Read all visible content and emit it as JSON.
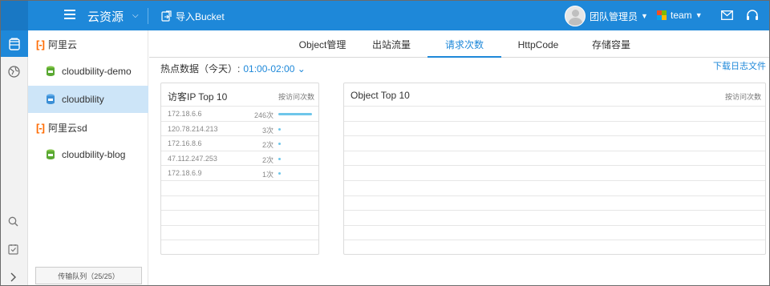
{
  "topbar": {
    "title": "云资源",
    "import_label": "导入Bucket",
    "user_name": "团队管理员",
    "team_name": "team"
  },
  "tree": {
    "accounts": [
      {
        "name": "阿里云",
        "buckets": [
          "cloudbility-demo",
          "cloudbility"
        ]
      },
      {
        "name": "阿里云sd",
        "buckets": [
          "cloudbility-blog"
        ]
      }
    ],
    "selected_bucket": "cloudbility",
    "transfer_queue": "传输队列（25/25）"
  },
  "tabs": [
    "Object管理",
    "出站流量",
    "请求次数",
    "HttpCode",
    "存储容量"
  ],
  "active_tab": "请求次数",
  "filter": {
    "label": "热点数据（今天）:",
    "time": "01:00-02:00"
  },
  "download_label": "下载日志文件",
  "ip_card": {
    "title": "访客IP Top 10",
    "sort_label": "按访问次数",
    "rows": [
      {
        "ip": "172.18.6.6",
        "count": "246次",
        "value": 246
      },
      {
        "ip": "120.78.214.213",
        "count": "3次",
        "value": 3
      },
      {
        "ip": "172.16.8.6",
        "count": "2次",
        "value": 2
      },
      {
        "ip": "47.112.247.253",
        "count": "2次",
        "value": 2
      },
      {
        "ip": "172.18.6.9",
        "count": "1次",
        "value": 1
      }
    ]
  },
  "object_card": {
    "title": "Object Top 10",
    "sort_label": "按访问次数"
  },
  "colors": {
    "brand": "#1e88d9",
    "bar": "#6ec6ea",
    "aliyun": "#ff6a00"
  }
}
